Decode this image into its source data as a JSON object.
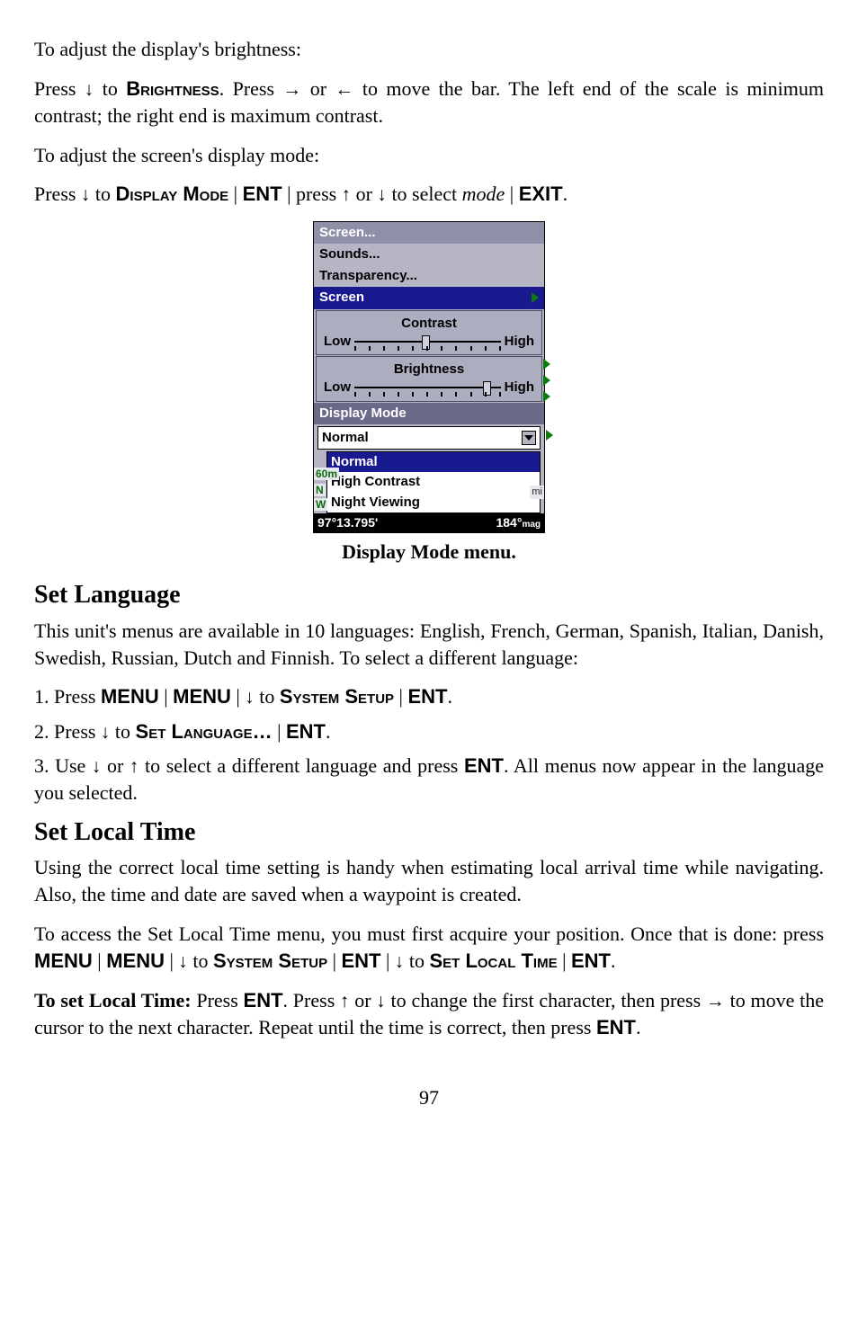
{
  "para1": "To adjust the display's brightness:",
  "para2_parts": {
    "a": "Press ",
    "arrow1": "↓",
    "b": " to ",
    "brightness": "Brightness",
    "c": ". Press ",
    "arrow2": "→",
    "d": " or ",
    "arrow3": "←",
    "e": " to move the bar. The left end of the scale is minimum contrast; the right end is maximum contrast."
  },
  "para3": "To adjust the screen's display mode:",
  "para4_parts": {
    "a": "Press ",
    "arrow1": "↓",
    "b": " to ",
    "dmode": "Display Mode",
    "sep1": " | ",
    "ent1": "ENT",
    "sep2": " | ",
    "c": "press ",
    "arrow2": "↑",
    "d": " or ",
    "arrow3": "↓",
    "e": " to select ",
    "mode": "mode",
    "sep3": " | ",
    "exit": "EXIT",
    "f": "."
  },
  "screenshot": {
    "menu1": "Screen...",
    "menu2": "Sounds...",
    "menu3": "Transparency...",
    "screen": "Screen",
    "contrast": "Contrast",
    "low": "Low",
    "high": "High",
    "brightness": "Brightness",
    "display_mode": "Display Mode",
    "normal_field": "Normal",
    "dd_normal": "Normal",
    "dd_high_contrast": "High Contrast",
    "dd_night": "Night Viewing",
    "badge60m": "60m",
    "badgeN": "N",
    "badgeW": "W",
    "mi": "mi",
    "coord": "97°13.795'",
    "bearing": "184°",
    "mag": "mag"
  },
  "caption": "Display Mode menu.",
  "h_setlang": "Set Language",
  "lang_para": "This unit's menus are available in 10 languages: English, French, German, Spanish, Italian, Danish, Swedish, Russian, Dutch and Finnish. To select a different language:",
  "step1": {
    "a": "1. Press ",
    "menu1": "MENU",
    "sep1": " | ",
    "menu2": "MENU",
    "sep2": " | ",
    "arrow": "↓",
    "b": " to ",
    "sys": "System Setup",
    "sep3": " | ",
    "ent": "ENT",
    "c": "."
  },
  "step2": {
    "a": "2. Press ",
    "arrow": "↓",
    "b": " to ",
    "setlang": "Set Language…",
    "sep": " | ",
    "ent": "ENT",
    "c": "."
  },
  "step3": {
    "a": "3. Use ",
    "arrow1": "↓",
    "b": " or ",
    "arrow2": "↑",
    "c": " to select a different language and press ",
    "ent": "ENT",
    "d": ". All menus now appear in the language you selected."
  },
  "h_setlocal": "Set Local Time",
  "local_para1": "Using the correct local time setting is handy when estimating local arrival time while navigating. Also, the time and date are saved when a waypoint is created.",
  "local_para2": {
    "a": "To access the Set Local Time menu, you must first acquire your position. Once that is done: press ",
    "menu1": "MENU",
    "sep1": " | ",
    "menu2": "MENU",
    "sep2": " | ",
    "arrow1": "↓",
    "b": " to ",
    "sys": "System Setup",
    "sep3": " | ",
    "ent1": "ENT",
    "sep4": " | ",
    "arrow2": "↓",
    "c": " to ",
    "slt": "Set Local Time",
    "sep5": " | ",
    "ent2": "ENT",
    "d": "."
  },
  "local_para3": {
    "lead": "To set Local Time:",
    "a": " Press ",
    "ent1": "ENT",
    "b": ". Press ",
    "arrow1": "↑",
    "c": " or ",
    "arrow2": "↓",
    "d": " to change the first character, then press ",
    "arrow3": "→",
    "e": " to move the cursor to the next character. Repeat until the time is correct, then press ",
    "ent2": "ENT",
    "f": "."
  },
  "pagenum": "97"
}
